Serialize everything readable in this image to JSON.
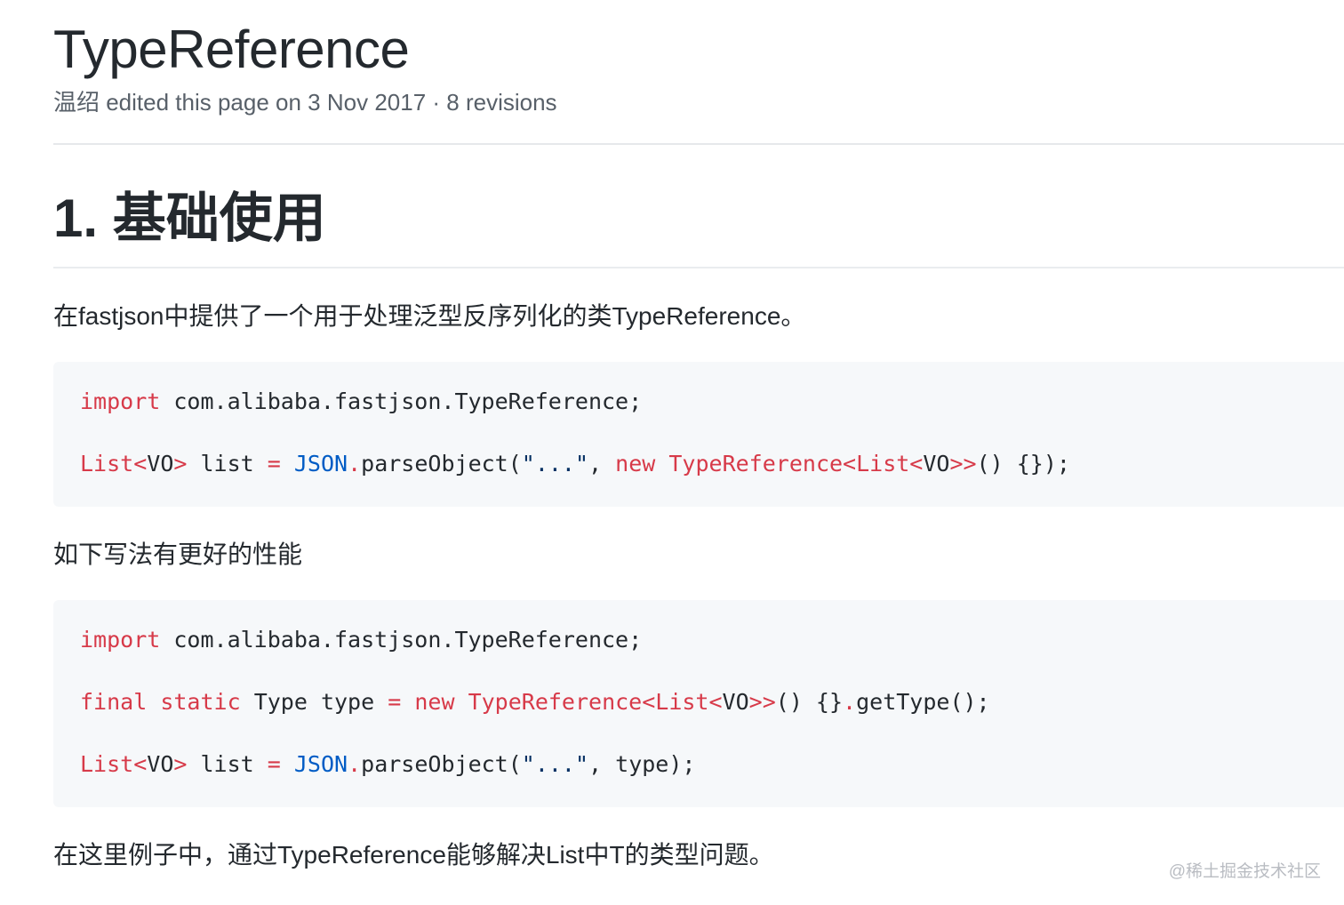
{
  "header": {
    "title": "TypeReference",
    "meta": "温绍 edited this page on 3 Nov 2017 · 8 revisions"
  },
  "content": {
    "section_heading": "1. 基础使用",
    "intro": "在fastjson中提供了一个用于处理泛型反序列化的类TypeReference。",
    "block1": {
      "line1": {
        "kw_import": "import",
        "pkg": " com.alibaba.fastjson.TypeReference;"
      },
      "line2": {
        "list": "List<",
        "vo": "VO",
        "gt": ">",
        "var": " list ",
        "eq": "=",
        "sp": " ",
        "json": "JSON",
        "dot": ".",
        "method": "parseObject(",
        "str": "\"...\"",
        "comma": ", ",
        "kw_new": "new",
        "sp2": " ",
        "tref": "TypeReference<List<",
        "vo2": "VO",
        "gt2": ">>",
        "tail": "() {});"
      }
    },
    "middle": "如下写法有更好的性能",
    "block2": {
      "line1": {
        "kw_import": "import",
        "pkg": " com.alibaba.fastjson.TypeReference;"
      },
      "line2": {
        "kw_final": "final",
        "sp1": " ",
        "kw_static": "static",
        "decl": " Type type ",
        "eq": "=",
        "sp2": " ",
        "kw_new": "new",
        "sp3": " ",
        "tref": "TypeReference<List<",
        "vo": "VO",
        "gt": ">>",
        "call": "() {}",
        "dot": ".",
        "tail": "getType();"
      },
      "line3": {
        "list": "List<",
        "vo": "VO",
        "gt": ">",
        "var": " list ",
        "eq": "=",
        "sp": " ",
        "json": "JSON",
        "dot": ".",
        "method": "parseObject(",
        "str": "\"...\"",
        "tail": ", type);"
      }
    },
    "conclusion": "在这里例子中，通过TypeReference能够解决List中T的类型问题。"
  },
  "watermark": "@稀土掘金技术社区",
  "colors": {
    "keyword": "#d73a49",
    "class": "#005cc5",
    "string": "#032f62",
    "code_background": "#f6f8fa",
    "meta_text": "#586069"
  }
}
